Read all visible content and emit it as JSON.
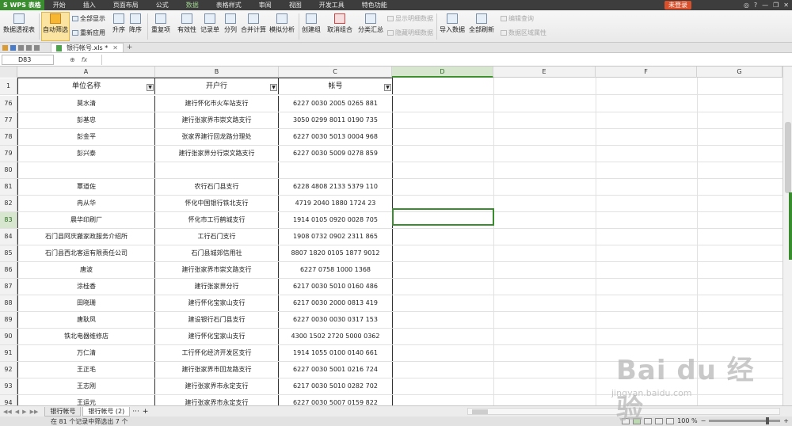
{
  "app": {
    "logo": "S WPS 表格",
    "login": "未登录"
  },
  "menu": [
    "开始",
    "插入",
    "页面布局",
    "公式",
    "数据",
    "表格样式",
    "审阅",
    "视图",
    "开发工具",
    "特色功能"
  ],
  "menu_active_index": 4,
  "ribbon": {
    "pivot": "数据透视表",
    "autofilter": "自动筛选",
    "showall": "全部显示",
    "reapply": "重新应用",
    "asc": "升序",
    "desc": "降序",
    "duplicates": "重复项",
    "validity": "有效性",
    "form": "记录单",
    "split": "分列",
    "consolidate": "合并计算",
    "whatif": "模拟分析",
    "group": "创建组",
    "ungroup": "取消组合",
    "subtotal": "分类汇总",
    "showdetail": "显示明细数据",
    "hidedetail": "隐藏明细数据",
    "import": "导入数据",
    "refreshall": "全部刷新",
    "editquery": "编辑查询",
    "rangeprops": "数据区域属性"
  },
  "doc_tab": "银行帐号.xls *",
  "namebox": "D83",
  "fx_label": "fx",
  "columns": [
    "A",
    "B",
    "C",
    "D",
    "E",
    "F",
    "G"
  ],
  "header_row": {
    "num": "1",
    "a": "单位名称",
    "b": "开户行",
    "c": "帐号"
  },
  "rows": [
    {
      "num": "76",
      "a": "莫水清",
      "b": "建行怀化市火车站支行",
      "c": "6227 0030 2005 0265 881"
    },
    {
      "num": "77",
      "a": "彭基忠",
      "b": "建行张家界市崇文路支行",
      "c": "3050 0299 8011 0190 735"
    },
    {
      "num": "78",
      "a": "彭金平",
      "b": "张家界建行回龙路分理处",
      "c": "6227 0030 5013 0004 968"
    },
    {
      "num": "79",
      "a": "彭兴泰",
      "b": "建行张家界分行崇文路支行",
      "c": "6227 0030 5009 0278 859"
    },
    {
      "num": "80",
      "a": "",
      "b": "",
      "c": ""
    },
    {
      "num": "81",
      "a": "覃道佐",
      "b": "农行石门县支行",
      "c": "6228 4808 2133 5379 110"
    },
    {
      "num": "82",
      "a": "冉从华",
      "b": "怀化中国银行铁北支行",
      "c": "4719 2040 1880 1724 23"
    },
    {
      "num": "83",
      "a": "晨华印刷厂",
      "b": "怀化市工行鹤城支行",
      "c": "1914 0105 0920 0028 705"
    },
    {
      "num": "84",
      "a": "石门县阿庆搬家政服务介绍所",
      "b": "工行石门支行",
      "c": "1908 0732 0902 2311 865"
    },
    {
      "num": "85",
      "a": "石门县西北客运有限责任公司",
      "b": "石门县城郊信用社",
      "c": "8807 1820 0105 1877 9012"
    },
    {
      "num": "86",
      "a": "唐波",
      "b": "建行张家界市崇文路支行",
      "c": "6227 0758 1000 1368"
    },
    {
      "num": "87",
      "a": "涂桂香",
      "b": "建行张家界分行",
      "c": "6217 0030 5010 0160 486"
    },
    {
      "num": "88",
      "a": "田晓珊",
      "b": "建行怀化宝家山支行",
      "c": "6217 0030 2000 0813 419"
    },
    {
      "num": "89",
      "a": "唐耿凤",
      "b": "建设银行石门县支行",
      "c": "6227 0030 0030 0317 153"
    },
    {
      "num": "90",
      "a": "铁北电器维修店",
      "b": "建行怀化宝家山支行",
      "c": "4300 1502 2720 5000 0362"
    },
    {
      "num": "91",
      "a": "万仁清",
      "b": "工行怀化经济开发区支行",
      "c": "1914 1055 0100 0140 661"
    },
    {
      "num": "92",
      "a": "王正毛",
      "b": "建行张家界市回龙路支行",
      "c": "6227 0030 5001 0216 724"
    },
    {
      "num": "93",
      "a": "王志刚",
      "b": "建行张家界市永定支行",
      "c": "6217 0030 5010 0282 702"
    },
    {
      "num": "94",
      "a": "王运元",
      "b": "建行张家界市永定支行",
      "c": "6227 0030 5007 0159 822"
    }
  ],
  "sheets": [
    "银行帐号",
    "银行帐号 (2)"
  ],
  "sheet_more": "···",
  "sheet_add": "+",
  "status_text": "在 81 个记录中筛选出 7 个",
  "zoom": "100 %",
  "watermark": {
    "brand": "Bai du 经验",
    "url": "jingyan.baidu.com"
  }
}
